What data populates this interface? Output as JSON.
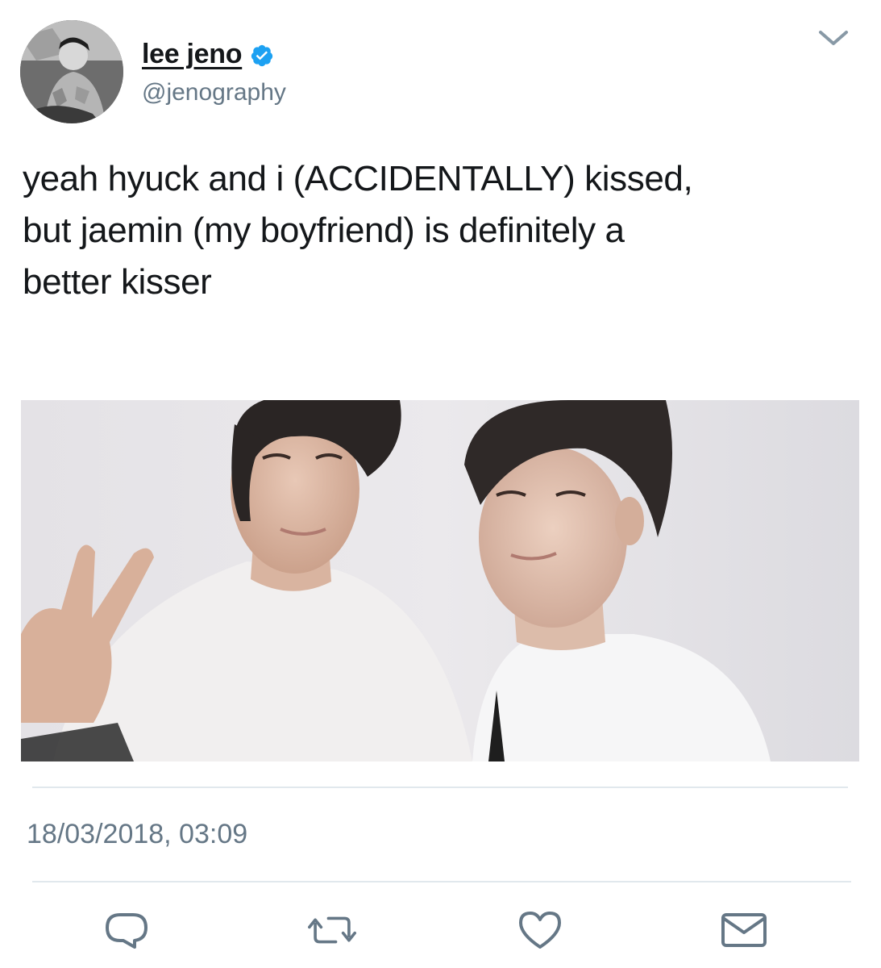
{
  "user": {
    "display_name": "lee jeno",
    "handle": "@jenography",
    "verified": true
  },
  "tweet": {
    "text_lines": [
      "yeah hyuck and i (ACCIDENTALLY) kissed,",
      "but jaemin (my boyfriend) is definitely a",
      "better kisser"
    ],
    "timestamp": "18/03/2018, 03:09"
  },
  "icons": {
    "verified": "verified-badge-icon",
    "more": "chevron-down-icon",
    "reply": "reply-icon",
    "retweet": "retweet-icon",
    "like": "heart-icon",
    "message": "envelope-icon"
  },
  "colors": {
    "verified_blue": "#1da1f2",
    "secondary_text": "#657786",
    "divider": "#e1e8ed",
    "primary_text": "#14171a"
  }
}
